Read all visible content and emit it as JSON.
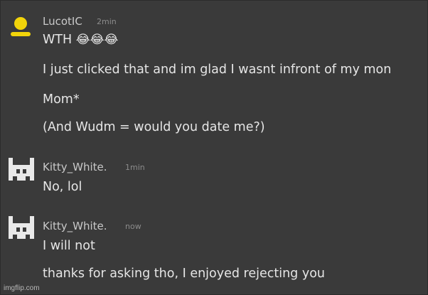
{
  "messages": [
    {
      "username": "LucotIC",
      "time": "2min",
      "avatar_icon": "yellow-person-icon",
      "lines": [
        "WTH",
        "I just clicked that and im glad I wasnt infront of my mon",
        "Mom*",
        "(And Wudm = would you date me?)"
      ],
      "emoji": "😂😂😂"
    },
    {
      "username": "Kitty_White.",
      "time": "1min",
      "avatar_icon": "pixel-avatar-icon",
      "lines": [
        "No, lol"
      ]
    },
    {
      "username": "Kitty_White.",
      "time": "now",
      "avatar_icon": "pixel-avatar-icon",
      "lines": [
        "I will not",
        "thanks for asking tho, I enjoyed rejecting you"
      ]
    }
  ],
  "watermark": "imgflip.com",
  "colors": {
    "background": "#3a3a3a",
    "text": "#e6e6e6",
    "username": "#c9c9c9",
    "time": "#8c8c8c",
    "avatar_yellow": "#f2d40a"
  }
}
